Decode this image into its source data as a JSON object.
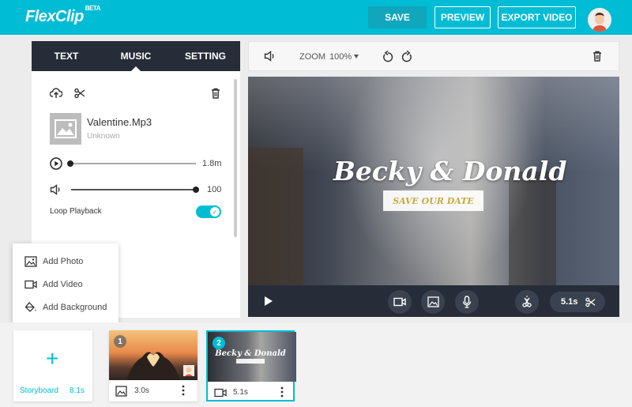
{
  "header": {
    "logo": "FlexClip",
    "logo_badge": "BETA",
    "save": "SAVE",
    "preview": "PREVIEW",
    "export": "EXPORT VIDEO",
    "color": "#00bcd4"
  },
  "panel": {
    "tabs": [
      "TEXT",
      "MUSIC",
      "SETTING"
    ],
    "active_tab": "MUSIC",
    "music": {
      "title": "Valentine.Mp3",
      "artist": "Unknown",
      "duration": "1.8m",
      "volume": "100",
      "progress_fraction": 0.0,
      "volume_fraction": 1.0,
      "loop_label": "Loop Playback",
      "loop_on": true
    }
  },
  "add_menu": {
    "items": [
      {
        "label": "Add Photo",
        "icon": "image-icon"
      },
      {
        "label": "Add Video",
        "icon": "video-icon"
      },
      {
        "label": "Add Background",
        "icon": "paint-bucket-icon"
      }
    ]
  },
  "toolbar": {
    "zoom_label": "ZOOM",
    "zoom_value": "100%"
  },
  "stage": {
    "title": "Becky & Donald",
    "subtitle": "SAVE OUR DATE"
  },
  "controls": {
    "duration": "5.1s"
  },
  "storyboard": {
    "label": "Storyboard",
    "total": "8.1s",
    "clips": [
      {
        "number": "1",
        "duration": "3.0s",
        "type": "image"
      },
      {
        "number": "2",
        "duration": "5.1s",
        "type": "video",
        "title": "Becky & Donald"
      }
    ]
  }
}
